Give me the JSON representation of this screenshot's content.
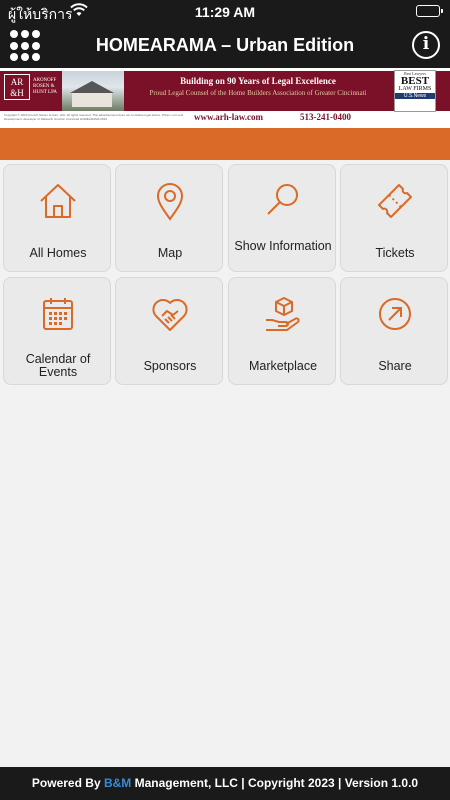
{
  "status_bar": {
    "carrier": "ผู้ให้บริการ",
    "time": "11:29 AM"
  },
  "navbar": {
    "title": "HOMEARAMA – Urban Edition",
    "menu_icon": "grid-dots-icon",
    "info_icon": "info-icon"
  },
  "banner": {
    "logo_text": "AR &H",
    "firm_name": "ARONOFF ROSEN & HUNT LPA",
    "headline": "Building on 90 Years of Legal Excellence",
    "subline": "Proud Legal Counsel of the Home Builders Association of Greater Cincinnati",
    "award_top": "Best Lawyers",
    "award_best": "BEST",
    "award_firms": "LAW FIRMS",
    "award_news": "U.S.News",
    "fine_print": "Copyright © 2023 Aronoff, Rosen & Hunt, LPA. All rights reserved. This advertisement does not constitute legal advice. Photo: Lot Lend Development, developer of Walworth Junction Cincinnati HOMEARAMA 2023",
    "url": "www.arh-law.com",
    "phone": "513-241-0400"
  },
  "colors": {
    "accent": "#d96a27",
    "bar": "#1a1a1a",
    "banner_red": "#7a1128",
    "tile_bg": "#eaeaea"
  },
  "tiles": [
    {
      "label": "All Homes",
      "icon": "house-icon"
    },
    {
      "label": "Map",
      "icon": "map-pin-icon"
    },
    {
      "label": "Show Information",
      "icon": "search-icon"
    },
    {
      "label": "Tickets",
      "icon": "ticket-icon"
    },
    {
      "label": "Calendar of Events",
      "icon": "calendar-icon"
    },
    {
      "label": "Sponsors",
      "icon": "handshake-heart-icon"
    },
    {
      "label": "Marketplace",
      "icon": "box-hand-icon"
    },
    {
      "label": "Share",
      "icon": "share-arrow-icon"
    }
  ],
  "footer": {
    "prefix": "Powered By ",
    "bm": "B&M",
    "suffix": " Management, LLC | Copyright 2023 | Version 1.0.0"
  }
}
